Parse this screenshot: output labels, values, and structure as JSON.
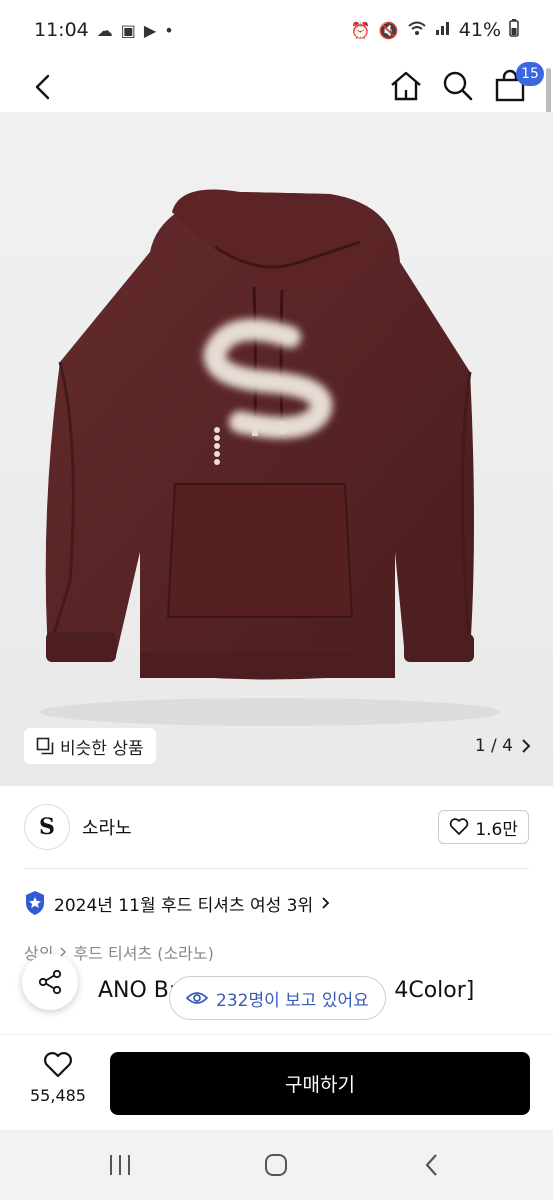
{
  "status_bar": {
    "time": "11:04",
    "dot": "•",
    "battery": "41%"
  },
  "cart": {
    "count": "15"
  },
  "image_overlay": {
    "similar_label": "비슷한 상품",
    "pager": "1 / 4"
  },
  "brand": {
    "logo_letter": "S",
    "name": "소라노",
    "likes": "1.6만"
  },
  "ranking": {
    "text": "2024년 11월 후드 티셔츠 여성 3위"
  },
  "breadcrumb": {
    "first": "상의",
    "second": "후드 티셔츠 (소라노)"
  },
  "product": {
    "title_left": "S",
    "title_mid": "ANO Ba",
    "title_right": "4Color]"
  },
  "viewers": {
    "text": "232명이 보고 있어요"
  },
  "buy_bar": {
    "wish_count": "55,485",
    "buy_label": "구매하기"
  },
  "colors": {
    "accent_blue": "#3a67e0",
    "hoodie": "#5a2526",
    "buy_button": "#000000"
  }
}
